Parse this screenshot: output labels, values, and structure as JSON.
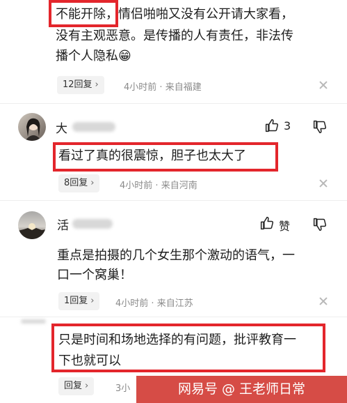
{
  "comments": [
    {
      "text_highlight": "不能开除",
      "text_rest": "，情侣啪啪又没有公开请大家看，",
      "text_line2": "没有主观恶意。是传播的人有责任，非法传",
      "text_line3": "播个人隐私",
      "emoji": "😁",
      "reply_label": "12回复",
      "time": "4小时前",
      "location": "来自福建"
    },
    {
      "username": "大",
      "like_count": "3",
      "text": "看过了真的很震惊，胆子也太大了",
      "reply_label": "8回复",
      "time": "4小时前",
      "location": "来自河南"
    },
    {
      "username": "活",
      "like_label": "赞",
      "text_line1": "重点是拍摄的几个女生那个激动的语气，一",
      "text_line2": "口一个窝巢！",
      "reply_label": "1回复",
      "time": "4小时前",
      "location": "来自江苏"
    },
    {
      "text_line1": "只是时间和场地选择的有问题，批评教育一",
      "text_line2": "下也就可以",
      "reply_label": "回复",
      "time_partial": "3小"
    }
  ],
  "watermark": "网易号 @ 王老师日常",
  "colors": {
    "highlight_red": "#e3262c",
    "watermark_bg": "#d64c46"
  },
  "icons": [
    "chevron-right-icon",
    "close-icon",
    "thumbs-up-icon",
    "thumbs-down-icon"
  ]
}
